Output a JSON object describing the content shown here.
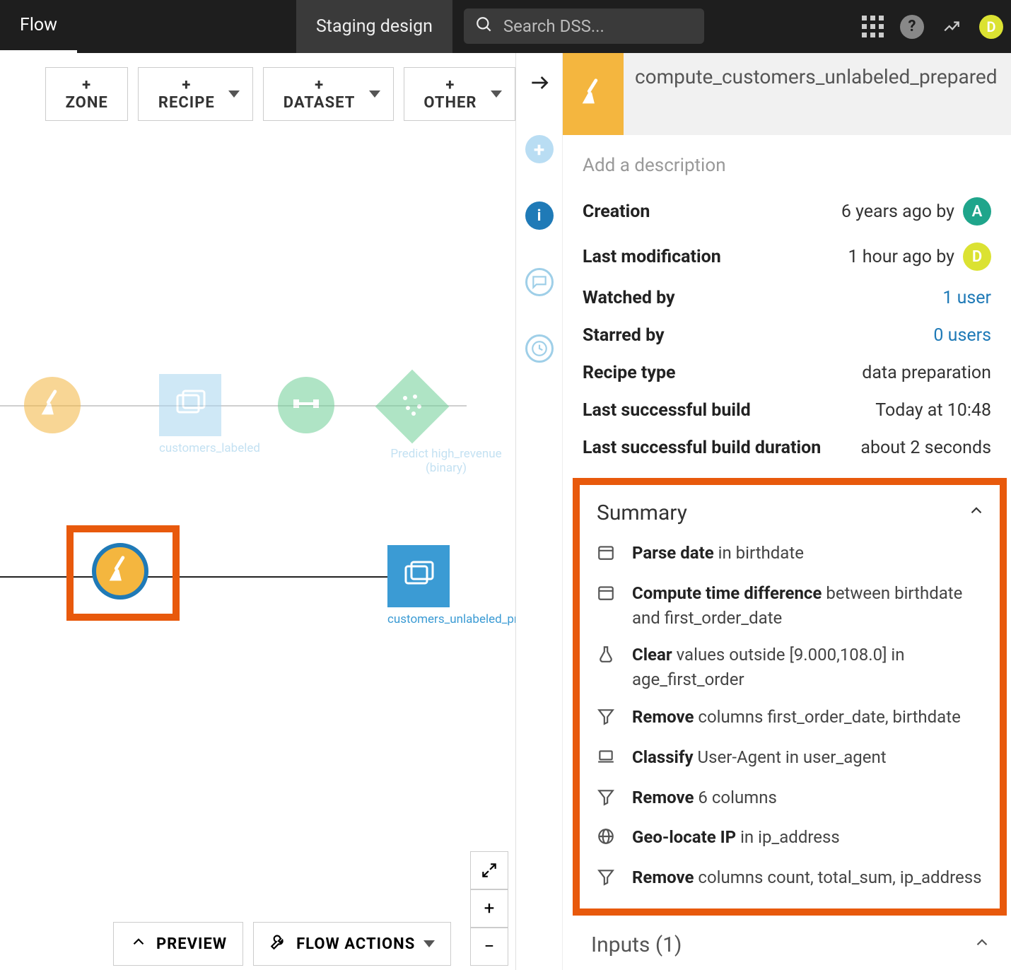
{
  "topbar": {
    "nav_flow": "Flow",
    "staging": "Staging design",
    "search_placeholder": "Search DSS..."
  },
  "flow_toolbar": {
    "zone": "+ ZONE",
    "recipe": "+ RECIPE",
    "dataset": "+ DATASET",
    "other": "+ OTHER"
  },
  "canvas": {
    "label_customers_labeled": "customers_labeled",
    "label_predict": "Predict high_revenue (binary)",
    "label_unlabeled_prepared": "customers_unlabeled_prepared"
  },
  "bottom_buttons": {
    "preview": "PREVIEW",
    "flow_actions": "FLOW ACTIONS"
  },
  "detail": {
    "title": "compute_customers_unlabeled_prepared",
    "desc_placeholder": "Add a description",
    "meta": {
      "creation_k": "Creation",
      "creation_v": "6 years ago by",
      "lastmod_k": "Last modification",
      "lastmod_v": "1 hour ago by",
      "watched_k": "Watched by",
      "watched_v": "1 user",
      "starred_k": "Starred by",
      "starred_v": "0 users",
      "type_k": "Recipe type",
      "type_v": "data preparation",
      "build_k": "Last successful build",
      "build_v": "Today at 10:48",
      "dur_k": "Last successful build duration",
      "dur_v": "about 2 seconds"
    },
    "summary_title": "Summary",
    "steps": {
      "s1_b": "Parse date",
      "s1_r": " in birthdate",
      "s2_b": "Compute time difference",
      "s2_r": " between birthdate and first_order_date",
      "s3_b": "Clear",
      "s3_r": " values outside [9.000,108.0] in age_first_order",
      "s4_b": "Remove",
      "s4_r": " columns first_order_date, birthdate",
      "s5_b": "Classify",
      "s5_r": " User-Agent in user_agent",
      "s6_b": "Remove",
      "s6_r": " 6 columns",
      "s7_b": "Geo-locate IP",
      "s7_r": " in ip_address",
      "s8_b": "Remove",
      "s8_r": " columns count, total_sum, ip_address"
    },
    "inputs_label": "Inputs (1)"
  },
  "avatars": {
    "creator": "A",
    "modifier": "D",
    "me": "D"
  }
}
